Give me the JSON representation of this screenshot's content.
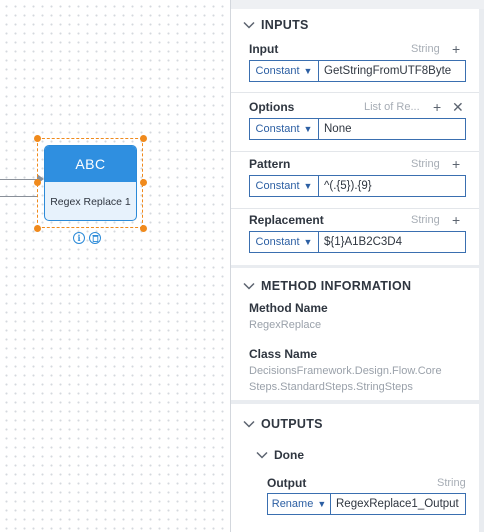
{
  "canvas": {
    "step": {
      "icon_text": "ABC",
      "name": "Regex Replace 1",
      "info_icon": "info-icon",
      "delete_icon": "trash-icon"
    }
  },
  "panel": {
    "inputs": {
      "header": "INPUTS",
      "fields": [
        {
          "label": "Input",
          "type": "String",
          "mode": "Constant",
          "value": "GetStringFromUTF8Byte"
        },
        {
          "label": "Options",
          "type": "List of Re...",
          "mode": "Constant",
          "value": "None"
        },
        {
          "label": "Pattern",
          "type": "String",
          "mode": "Constant",
          "value": "^(.{5}).{9}"
        },
        {
          "label": "Replacement",
          "type": "String",
          "mode": "Constant",
          "value": "${1}A1B2C3D4"
        }
      ]
    },
    "method_information": {
      "header": "METHOD INFORMATION",
      "method_name_label": "Method Name",
      "method_name_value": "RegexReplace",
      "class_name_label": "Class Name",
      "class_name_value_line1": "DecisionsFramework.Design.Flow.Core",
      "class_name_value_line2": "Steps.StandardSteps.StringSteps"
    },
    "outputs": {
      "header": "OUTPUTS",
      "path_name": "Done",
      "output_label": "Output",
      "output_type": "String",
      "output_mode": "Rename",
      "output_value": "RegexReplace1_Output"
    }
  },
  "colors": {
    "accent": "#2f8fe0",
    "selection": "#f08a1c",
    "panel_bg": "#e9ecf0"
  }
}
